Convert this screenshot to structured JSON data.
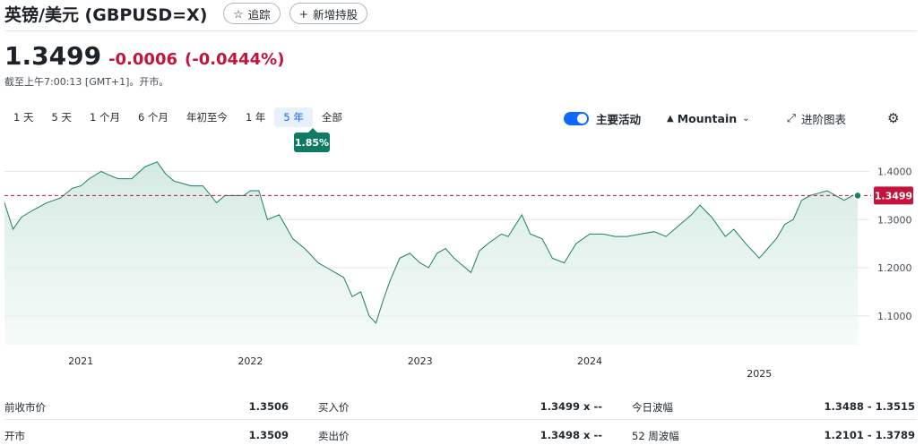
{
  "header": {
    "title": "英镑/美元 (GBPUSD=X)",
    "follow_label": "追踪",
    "follow_icon": "star-icon",
    "add_holding_label": "新增持股",
    "add_icon": "plus-icon"
  },
  "quote": {
    "price": "1.3499",
    "change": "-0.0006",
    "change_pct": "(-0.0444%)",
    "as_of": "截至上午7:00:13 [GMT+1]。开市。",
    "change_color": "#c3143c"
  },
  "ranges": [
    {
      "label": "1 天"
    },
    {
      "label": "5 天"
    },
    {
      "label": "1 个月"
    },
    {
      "label": "6 个月"
    },
    {
      "label": "年初至今"
    },
    {
      "label": "1 年"
    },
    {
      "label": "5 年",
      "active": true
    },
    {
      "label": "全部"
    }
  ],
  "range_return": "1.85%",
  "controls": {
    "key_events_label": "主要活动",
    "chart_type_label": "Mountain",
    "advanced_chart_label": "进阶图表",
    "mountain_icon": "mountain-icon",
    "expand_icon": "expand-icon",
    "settings_icon": "gear-icon"
  },
  "chart_data": {
    "type": "area",
    "x_ticks": [
      "2021",
      "2022",
      "2023",
      "2024",
      "2025"
    ],
    "y_ticks": [
      "1.4000",
      "1.3000",
      "1.2000",
      "1.1000"
    ],
    "ylim": [
      1.04,
      1.44
    ],
    "current_price": 1.3499,
    "current_label": "1.3499",
    "line_color": "#1a7f64",
    "fill_color": "#dcefe8",
    "current_color": "#c3143c",
    "grid": true,
    "x": [
      2020.55,
      2020.6,
      2020.65,
      2020.72,
      2020.8,
      2020.88,
      2020.95,
      2021.0,
      2021.05,
      2021.12,
      2021.15,
      2021.22,
      2021.3,
      2021.38,
      2021.45,
      2021.5,
      2021.55,
      2021.6,
      2021.65,
      2021.72,
      2021.8,
      2021.85,
      2021.9,
      2021.96,
      2022.0,
      2022.05,
      2022.1,
      2022.17,
      2022.25,
      2022.32,
      2022.4,
      2022.45,
      2022.5,
      2022.55,
      2022.6,
      2022.65,
      2022.7,
      2022.74,
      2022.78,
      2022.82,
      2022.88,
      2022.94,
      2023.0,
      2023.05,
      2023.1,
      2023.15,
      2023.2,
      2023.3,
      2023.35,
      2023.4,
      2023.48,
      2023.52,
      2023.6,
      2023.65,
      2023.72,
      2023.78,
      2023.85,
      2023.92,
      2024.0,
      2024.08,
      2024.15,
      2024.22,
      2024.3,
      2024.38,
      2024.45,
      2024.5,
      2024.55,
      2024.6,
      2024.65,
      2024.72,
      2024.8,
      2024.85,
      2024.92,
      2025.0,
      2025.05,
      2025.1,
      2025.15,
      2025.2,
      2025.25,
      2025.3,
      2025.35,
      2025.4,
      2025.45,
      2025.5,
      2025.55,
      2025.58
    ],
    "y": [
      1.335,
      1.28,
      1.305,
      1.32,
      1.335,
      1.345,
      1.365,
      1.37,
      1.385,
      1.4,
      1.395,
      1.385,
      1.385,
      1.41,
      1.42,
      1.395,
      1.38,
      1.375,
      1.37,
      1.37,
      1.335,
      1.35,
      1.35,
      1.35,
      1.36,
      1.36,
      1.3,
      1.31,
      1.26,
      1.24,
      1.21,
      1.2,
      1.19,
      1.18,
      1.14,
      1.15,
      1.1,
      1.085,
      1.13,
      1.17,
      1.22,
      1.23,
      1.21,
      1.2,
      1.23,
      1.24,
      1.22,
      1.19,
      1.235,
      1.25,
      1.27,
      1.265,
      1.31,
      1.27,
      1.26,
      1.22,
      1.21,
      1.25,
      1.27,
      1.27,
      1.265,
      1.265,
      1.27,
      1.275,
      1.265,
      1.28,
      1.295,
      1.31,
      1.33,
      1.305,
      1.265,
      1.28,
      1.25,
      1.22,
      1.24,
      1.26,
      1.29,
      1.3,
      1.34,
      1.35,
      1.355,
      1.36,
      1.35,
      1.34,
      1.35,
      1.3499
    ]
  },
  "stats": [
    [
      {
        "label": "前收市价",
        "value": "1.3506"
      },
      {
        "label": "买入价",
        "value": "1.3499 x --"
      },
      {
        "label": "今日波幅",
        "value": "1.3488 - 1.3515"
      }
    ],
    [
      {
        "label": "开市",
        "value": "1.3509"
      },
      {
        "label": "卖出价",
        "value": "1.3498 x --"
      },
      {
        "label": "52 周波幅",
        "value": "1.2101 - 1.3789"
      }
    ]
  ]
}
